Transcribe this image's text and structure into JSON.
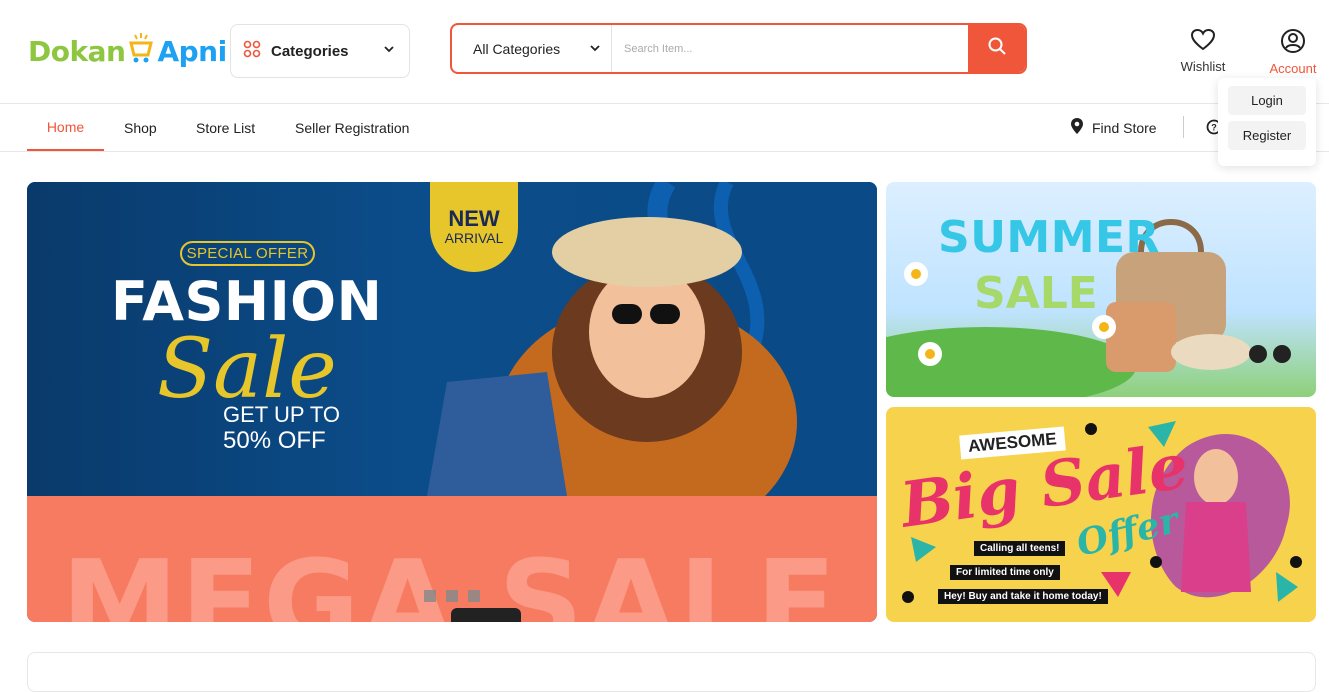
{
  "brand": {
    "name_part1": "Dokan",
    "name_part2": "Apni"
  },
  "header": {
    "categories_label": "Categories",
    "search": {
      "category_selected": "All Categories",
      "placeholder": "Search Item..."
    },
    "wishlist_label": "Wishlist",
    "account_label": "Account",
    "account_menu": [
      "Login",
      "Register"
    ]
  },
  "nav": {
    "items": [
      "Home",
      "Shop",
      "Store List",
      "Seller Registration"
    ],
    "active": "Home",
    "find_store": "Find Store"
  },
  "banners": {
    "hero": {
      "special_offer": "SPECIAL OFFER",
      "headline": "FASHION",
      "script": "Sale",
      "discount_line1": "GET UP TO",
      "discount_line2": "50% OFF",
      "badge_line1": "NEW",
      "badge_line2": "ARRIVAL",
      "next_slide_text": "MEGA SALE",
      "slide_count": 3
    },
    "summer": {
      "line1": "SUMMER",
      "line2": "SALE"
    },
    "big_sale": {
      "awesome": "AWESOME",
      "big_sale": "Big Sale",
      "offer": "Offer",
      "tag1": "Calling all teens!",
      "tag2": "For limited time only",
      "tag3": "Hey! Buy and take it home today!"
    }
  },
  "colors": {
    "accent": "#f0563a",
    "logo_green": "#8dc63f",
    "logo_blue": "#1da1f2"
  }
}
